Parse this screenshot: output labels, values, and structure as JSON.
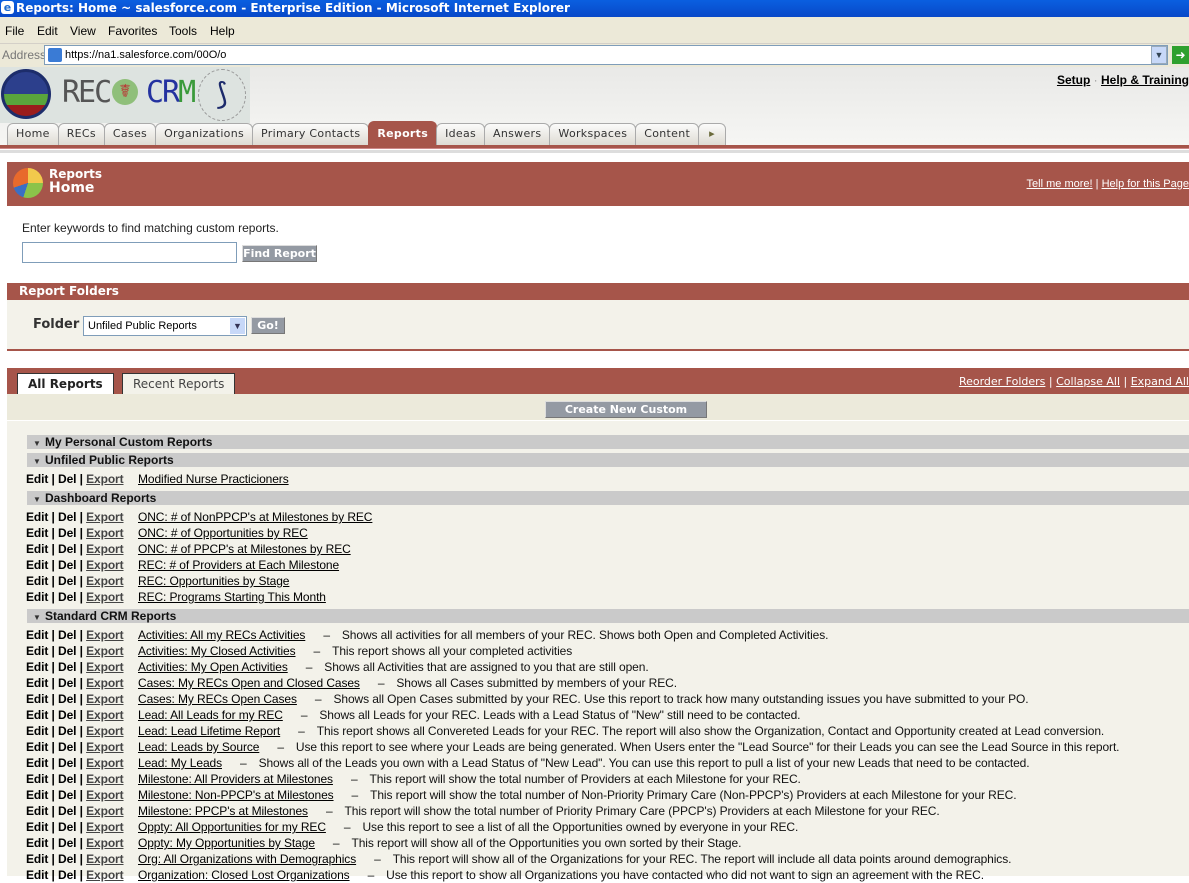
{
  "browser": {
    "title": "Reports: Home ~ salesforce.com - Enterprise Edition - Microsoft Internet Explorer",
    "menu": [
      "File",
      "Edit",
      "View",
      "Favorites",
      "Tools",
      "Help"
    ],
    "address_label": "Address",
    "url": "https://na1.salesforce.com/00O/o"
  },
  "header": {
    "logo_text": "REC CRM",
    "links": {
      "setup": "Setup",
      "help": "Help & Training"
    },
    "tabs": [
      "Home",
      "RECs",
      "Cases",
      "Organizations",
      "Primary Contacts",
      "Reports",
      "Ideas",
      "Answers",
      "Workspaces",
      "Content",
      "▸"
    ],
    "active_tab": "Reports"
  },
  "page": {
    "title_top": "Reports",
    "title_bottom": "Home",
    "tell_more": "Tell me more!",
    "help_page": "Help for this Page",
    "search_label": "Enter keywords to find matching custom reports.",
    "search_value": "",
    "find_button": "Find Report"
  },
  "folders": {
    "title": "Report Folders",
    "label": "Folder",
    "selected": "Unfiled Public Reports",
    "go": "Go!"
  },
  "reports": {
    "tabs": {
      "all": "All Reports",
      "recent": "Recent Reports"
    },
    "links": {
      "reorder": "Reorder Folders",
      "collapse": "Collapse All",
      "expand": "Expand All"
    },
    "create_button": "Create New Custom Report",
    "action_labels": {
      "edit": "Edit",
      "del": "Del",
      "export": "Export",
      "sep": "|"
    },
    "dash": "–",
    "sections": [
      {
        "title": "My Personal Custom Reports",
        "items": []
      },
      {
        "title": "Unfiled Public Reports",
        "items": [
          {
            "name": "Modified Nurse Practicioners",
            "desc": ""
          }
        ]
      },
      {
        "title": "Dashboard Reports",
        "items": [
          {
            "name": "ONC: # of NonPPCP's at Milestones by REC",
            "desc": ""
          },
          {
            "name": "ONC: # of Opportunities by REC",
            "desc": ""
          },
          {
            "name": "ONC: # of PPCP's at Milestones by REC",
            "desc": ""
          },
          {
            "name": "REC: # of Providers at Each Milestone",
            "desc": ""
          },
          {
            "name": "REC: Opportunities by Stage",
            "desc": ""
          },
          {
            "name": "REC: Programs Starting This Month",
            "desc": ""
          }
        ]
      },
      {
        "title": "Standard CRM Reports",
        "items": [
          {
            "name": "Activities: All my RECs Activities",
            "desc": "Shows all activities for all members of your REC. Shows both Open and Completed Activities."
          },
          {
            "name": "Activities: My Closed Activities",
            "desc": "This report shows all your completed activities"
          },
          {
            "name": "Activities: My Open Activities",
            "desc": "Shows all Activities that are assigned to you that are still open."
          },
          {
            "name": "Cases: My RECs Open and Closed Cases",
            "desc": "Shows all Cases submitted by members of your REC."
          },
          {
            "name": "Cases: My RECs Open Cases",
            "desc": "Shows all Open Cases submitted by your REC. Use this report to track how many outstanding issues you have submitted to your PO."
          },
          {
            "name": "Lead: All Leads for my REC",
            "desc": "Shows all Leads for your REC. Leads with a Lead Status of \"New\" still need to be contacted."
          },
          {
            "name": "Lead: Lead Lifetime Report",
            "desc": "This report shows all Convereted Leads for your REC. The report will also show the Organization, Contact and Opportunity created at Lead conversion."
          },
          {
            "name": "Lead: Leads by Source",
            "desc": "Use this report to see where your Leads are being generated. When Users enter the \"Lead Source\" for their Leads you can see the Lead Source in this report."
          },
          {
            "name": "Lead: My Leads",
            "desc": "Shows all of the Leads you own with a Lead Status of \"New Lead\". You can use this report to pull a list of your new Leads that need to be contacted."
          },
          {
            "name": "Milestone: All Providers at Milestones",
            "desc": "This report will show the total number of Providers at each Milestone for your REC."
          },
          {
            "name": "Milestone: Non-PPCP's at Milestones",
            "desc": "This report will show the total number of Non-Priority Primary Care (Non-PPCP's) Providers at each Milestone for your REC."
          },
          {
            "name": "Milestone: PPCP's at Milestones",
            "desc": "This report will show the total number of Priority Primary Care (PPCP's) Providers at each Milestone for your REC."
          },
          {
            "name": "Oppty: All Opportunities for my REC",
            "desc": "Use this report to see a list of all the Opportunities owned by everyone in your REC."
          },
          {
            "name": "Oppty: My Opportunities by Stage",
            "desc": "This report will show all of the Opportunities you own sorted by their Stage."
          },
          {
            "name": "Org: All Organizations with Demographics",
            "desc": "This report will show all of the Organizations for your REC. The report will include all data points around demographics."
          },
          {
            "name": "Organization: Closed Lost Organizations",
            "desc": "Use this report to show all Organizations you have contacted who did not want to sign an agreement with the REC."
          }
        ]
      }
    ]
  },
  "colors": {
    "brand": "#a6554a",
    "section": "#cacaca",
    "background": "#f3f2ea"
  }
}
